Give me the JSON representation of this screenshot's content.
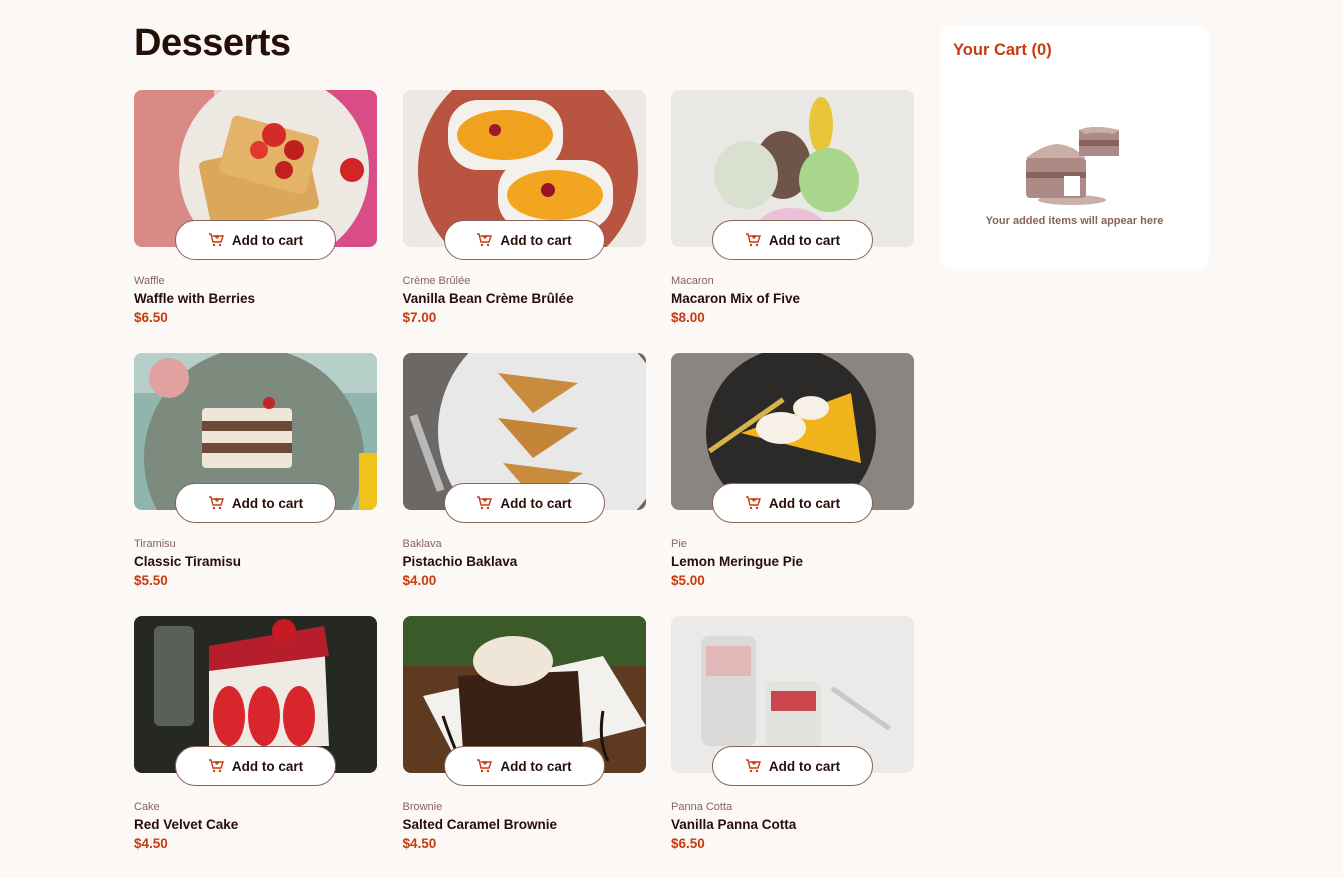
{
  "page": {
    "title": "Desserts"
  },
  "labels": {
    "add_to_cart": "Add to cart"
  },
  "products": [
    {
      "category": "Waffle",
      "name": "Waffle with Berries",
      "price": "$6.50"
    },
    {
      "category": "Crème Brûlée",
      "name": "Vanilla Bean Crème Brûlée",
      "price": "$7.00"
    },
    {
      "category": "Macaron",
      "name": "Macaron Mix of Five",
      "price": "$8.00"
    },
    {
      "category": "Tiramisu",
      "name": "Classic Tiramisu",
      "price": "$5.50"
    },
    {
      "category": "Baklava",
      "name": "Pistachio Baklava",
      "price": "$4.00"
    },
    {
      "category": "Pie",
      "name": "Lemon Meringue Pie",
      "price": "$5.00"
    },
    {
      "category": "Cake",
      "name": "Red Velvet Cake",
      "price": "$4.50"
    },
    {
      "category": "Brownie",
      "name": "Salted Caramel Brownie",
      "price": "$4.50"
    },
    {
      "category": "Panna Cotta",
      "name": "Vanilla Panna Cotta",
      "price": "$6.50"
    }
  ],
  "cart": {
    "title": "Your Cart (0)",
    "empty_message": "Your added items will appear here"
  },
  "colors": {
    "accent": "#c73b0f",
    "text": "#260f08",
    "muted": "#87635a",
    "background": "#fcf8f6"
  }
}
